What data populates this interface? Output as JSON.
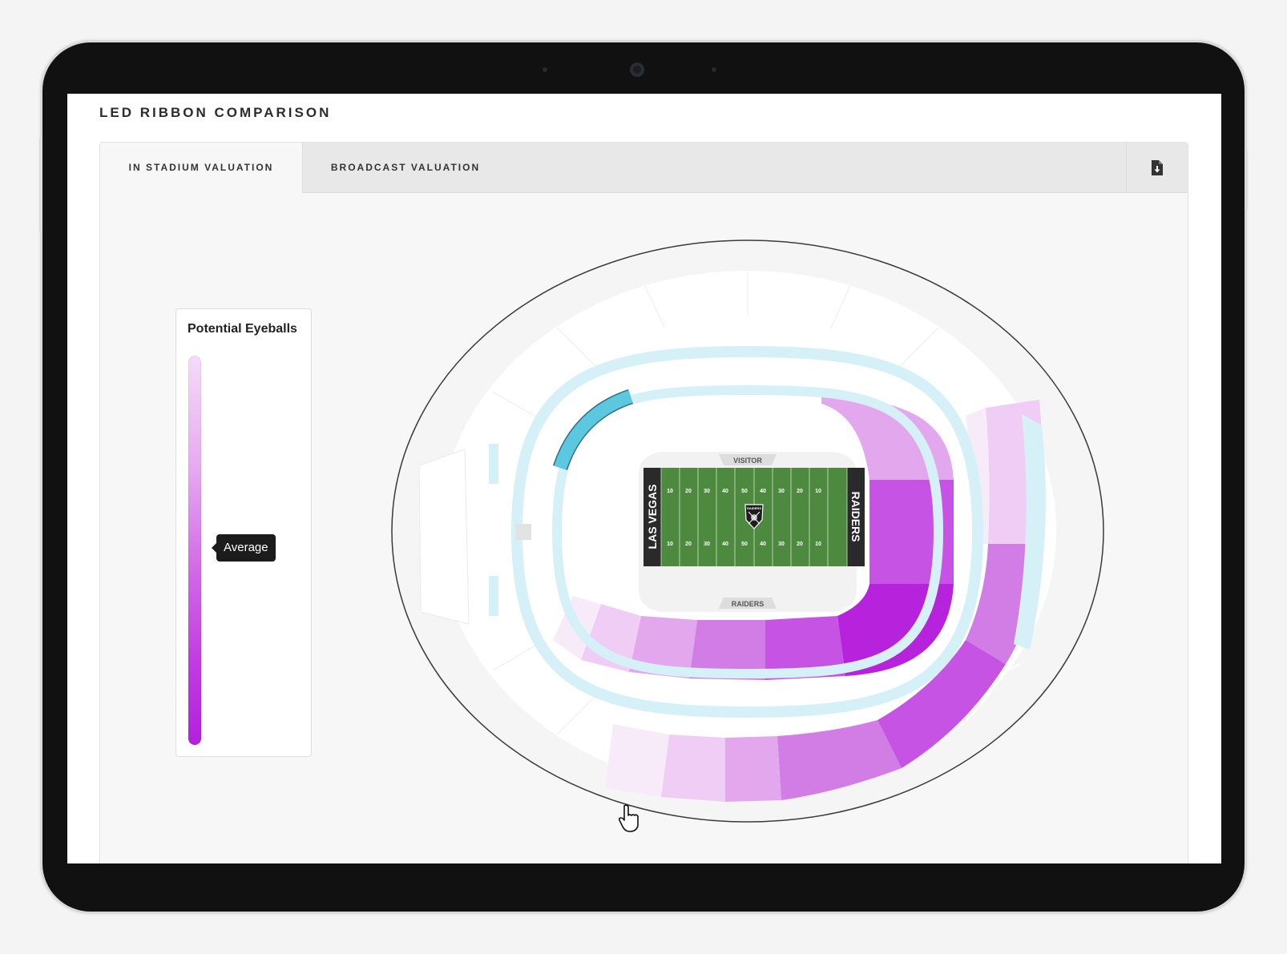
{
  "page": {
    "title": "LED RIBBON COMPARISON"
  },
  "tabs": [
    {
      "label": "IN STADIUM VALUATION",
      "active": true
    },
    {
      "label": "BROADCAST VALUATION",
      "active": false
    }
  ],
  "toolbar": {
    "download_icon": "download-file-icon"
  },
  "legend": {
    "title": "Potential Eyeballs",
    "marker_label": "Average",
    "marker_level": 0.5,
    "gradient_colors": [
      "#f4dcf8",
      "#e6a7f0",
      "#d16ae6",
      "#bf3ae0",
      "#b320df"
    ]
  },
  "stadium_map": {
    "field": {
      "visitor_label": "VISITOR",
      "home_label": "RAIDERS",
      "left_endzone_text": "LAS VEGAS",
      "right_endzone_text": "RAIDERS",
      "yard_numbers": [
        "10",
        "20",
        "30",
        "40",
        "50",
        "40",
        "30",
        "20",
        "10"
      ],
      "logo_text": "RAIDERS",
      "field_color": "#4d8a3f",
      "endzone_color": "#2a2a2a"
    },
    "ribbon_color": "#d5f1f7",
    "selected_segment_color": "#5bc8e0",
    "heat_colors": [
      "#f7ebfa",
      "#efcdf5",
      "#e3a7ee",
      "#d27de6",
      "#c653e4",
      "#b722dd"
    ]
  },
  "cursor": {
    "icon": "hand-pointer-icon"
  }
}
